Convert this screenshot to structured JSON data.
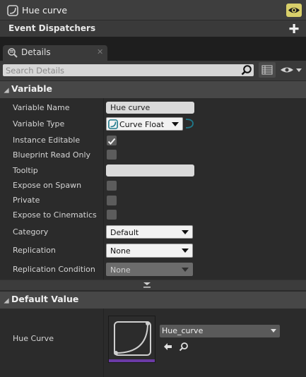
{
  "variable_row": {
    "name": "Hue curve"
  },
  "event_dispatchers": {
    "label": "Event Dispatchers"
  },
  "tab": {
    "label": "Details"
  },
  "search": {
    "placeholder": "Search Details"
  },
  "sections": {
    "variable": {
      "title": "Variable",
      "properties": {
        "variable_name": {
          "label": "Variable Name",
          "value": "Hue curve"
        },
        "variable_type": {
          "label": "Variable Type",
          "value": "Curve Float"
        },
        "instance_editable": {
          "label": "Instance Editable",
          "checked": true
        },
        "blueprint_read_only": {
          "label": "Blueprint Read Only",
          "checked": false
        },
        "tooltip": {
          "label": "Tooltip",
          "value": ""
        },
        "expose_on_spawn": {
          "label": "Expose on Spawn",
          "checked": false
        },
        "private": {
          "label": "Private",
          "checked": false
        },
        "expose_to_cinematics": {
          "label": "Expose to Cinematics",
          "checked": false
        },
        "category": {
          "label": "Category",
          "value": "Default"
        },
        "replication": {
          "label": "Replication",
          "value": "None"
        },
        "replication_condition": {
          "label": "Replication Condition",
          "value": "None"
        }
      }
    },
    "default_value": {
      "title": "Default Value",
      "hue_curve": {
        "label": "Hue Curve",
        "asset": "Hue_curve"
      }
    }
  },
  "colors": {
    "accent_purple": "#6b3aa6",
    "eye_toggle": "#d8cf6a",
    "curve_type": "#1f7a8c"
  },
  "icons": [
    "curve-float-icon",
    "eye-icon",
    "plus-icon",
    "details-icon",
    "close-icon",
    "search-icon",
    "view-options-icon",
    "checkmark-icon",
    "chevron-down-icon",
    "browse-arrow-icon",
    "find-icon"
  ]
}
